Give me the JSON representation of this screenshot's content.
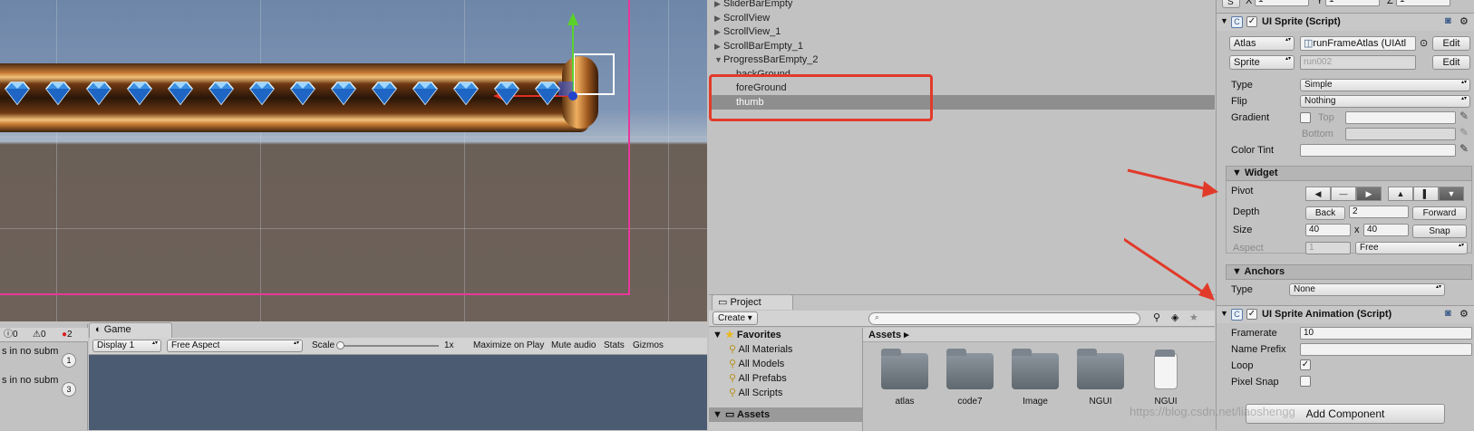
{
  "scene": {
    "accent_frame": "#e8389a"
  },
  "hierarchy": {
    "items": [
      {
        "label": "SliderBarEmpty",
        "indent": 1,
        "arrow": "▶"
      },
      {
        "label": "ScrollView",
        "indent": 1,
        "arrow": "▶"
      },
      {
        "label": "ScrollView_1",
        "indent": 1,
        "arrow": "▶"
      },
      {
        "label": "ScrollBarEmpty_1",
        "indent": 1,
        "arrow": "▶"
      },
      {
        "label": "ProgressBarEmpty_2",
        "indent": 1,
        "arrow": "▼"
      },
      {
        "label": "backGround",
        "indent": 2,
        "arrow": ""
      },
      {
        "label": "foreGround",
        "indent": 2,
        "arrow": ""
      },
      {
        "label": "thumb",
        "indent": 2,
        "arrow": "",
        "selected": true
      }
    ]
  },
  "project": {
    "tab": "Project",
    "create_label": "Create ▾",
    "favorites_label": "Favorites",
    "favorites": [
      "All Materials",
      "All Models",
      "All Prefabs",
      "All Scripts"
    ],
    "assets_tree_label": "Assets",
    "breadcrumb": "Assets ▸",
    "folders": [
      "atlas",
      "code7",
      "Image",
      "NGUI",
      "NGUI"
    ]
  },
  "console": {
    "counts": {
      "info": "0",
      "warn": "0",
      "error": "2"
    },
    "lines": [
      {
        "text": "s in no subm",
        "badge": "1"
      },
      {
        "text": "s in no subm",
        "badge": "3"
      }
    ]
  },
  "game": {
    "tab": "Game",
    "display": "Display 1",
    "aspect": "Free Aspect",
    "scale_label": "Scale",
    "scale_value": "1x",
    "maximize": "Maximize on Play",
    "mute": "Mute audio",
    "stats": "Stats",
    "gizmos": "Gizmos"
  },
  "inspector": {
    "transform_row": {
      "s": "S",
      "x_label": "X",
      "x": "1",
      "y_label": "Y",
      "y": "1",
      "z_label": "Z",
      "z": "1"
    },
    "sprite_component": {
      "title": "UI Sprite (Script)",
      "atlas_label": "Atlas",
      "atlas_value": "runFrameAtlas (UIAtl",
      "sprite_label": "Sprite",
      "sprite_value": "run002",
      "edit": "Edit",
      "type_label": "Type",
      "type_value": "Simple",
      "flip_label": "Flip",
      "flip_value": "Nothing",
      "gradient_label": "Gradient",
      "top_label": "Top",
      "bottom_label": "Bottom",
      "color_tint_label": "Color Tint"
    },
    "widget": {
      "header": "Widget",
      "pivot_label": "Pivot",
      "depth_label": "Depth",
      "depth_back": "Back",
      "depth_value": "2",
      "depth_forward": "Forward",
      "size_label": "Size",
      "size_w": "40",
      "size_x": "x",
      "size_h": "40",
      "snap": "Snap",
      "aspect_label": "Aspect",
      "aspect_value": "1",
      "aspect_mode": "Free"
    },
    "anchors": {
      "header": "Anchors",
      "type_label": "Type",
      "type_value": "None"
    },
    "animation_component": {
      "title": "UI Sprite Animation (Script)",
      "framerate_label": "Framerate",
      "framerate_value": "10",
      "name_prefix_label": "Name Prefix",
      "name_prefix_value": "",
      "loop_label": "Loop",
      "loop_checked": true,
      "pixel_snap_label": "Pixel Snap",
      "pixel_snap_checked": false
    },
    "add_component": "Add Component",
    "watermark": "https://blog.csdn.net/liaoshengg"
  },
  "annotation_color": "#e23a2a"
}
